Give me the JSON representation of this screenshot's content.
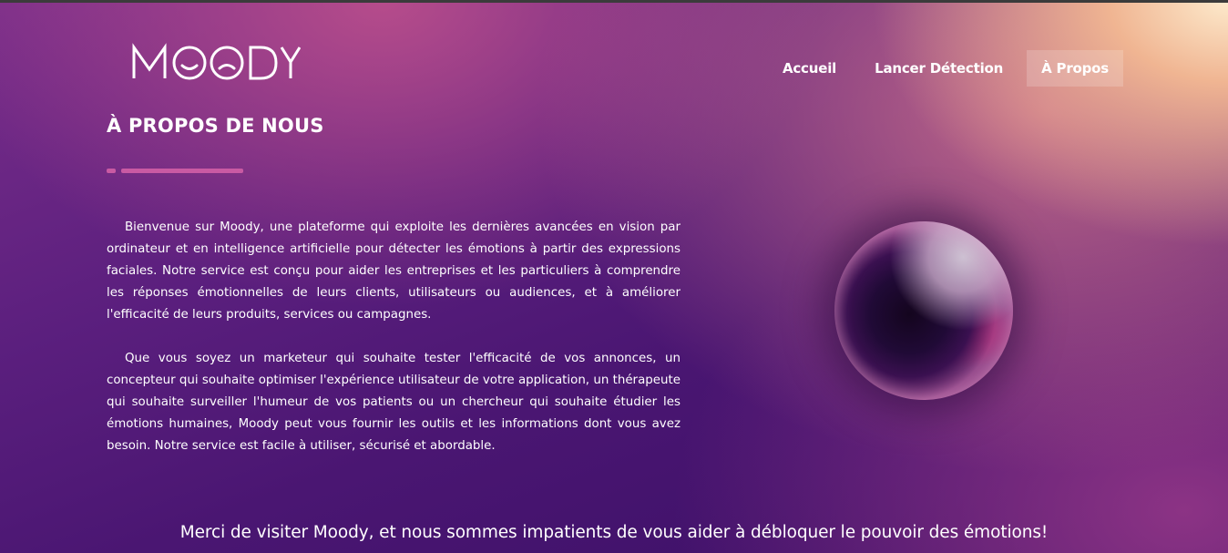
{
  "brand": {
    "name": "MOODY"
  },
  "nav": {
    "items": [
      {
        "label": "Accueil"
      },
      {
        "label": "Lancer Détection"
      },
      {
        "label": "À Propos"
      }
    ],
    "active": "À Propos"
  },
  "about": {
    "title": "À PROPOS DE NOUS",
    "paragraphs": [
      "Bienvenue sur Moody, une plateforme qui exploite les dernières avancées en vision par ordinateur et en intelligence artificielle pour détecter les émotions à partir des expressions faciales. Notre service est conçu pour aider les entreprises et les particuliers à comprendre les réponses émotionnelles de leurs clients, utilisateurs ou audiences, et à améliorer l'efficacité de leurs produits, services ou campagnes.",
      "Que vous soyez un marketeur qui souhaite tester l'efficacité de vos annonces, un concepteur qui souhaite optimiser l'expérience utilisateur de votre application, un thérapeute qui souhaite surveiller l'humeur de vos patients ou un chercheur qui souhaite étudier les émotions humaines, Moody peut vous fournir les outils et les informations dont vous avez besoin. Notre service est facile à utiliser, sécurisé et abordable."
    ]
  },
  "footer": {
    "message": "Merci de visiter Moody, et nous sommes impatients de vous aider à débloquer le pouvoir des émotions!"
  },
  "colors": {
    "accent": "#c95aa3",
    "background_dark": "#3a0f66",
    "background_light": "#fdeacc"
  }
}
